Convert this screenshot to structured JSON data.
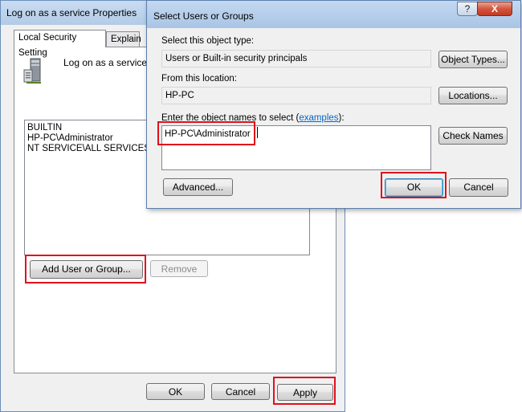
{
  "back_window": {
    "title": "Log on as a service Properties",
    "tabs": [
      "Local Security Setting",
      "Explain"
    ],
    "policy_name": "Log on as a service",
    "members": [
      "BUILTIN",
      "HP-PC\\Administrator",
      "NT SERVICE\\ALL SERVICES"
    ],
    "add_button": "Add User or Group...",
    "remove_button": "Remove",
    "ok_button": "OK",
    "cancel_button": "Cancel",
    "apply_button": "Apply"
  },
  "dialog": {
    "title": "Select Users or Groups",
    "help_glyph": "?",
    "close_glyph": "X",
    "object_type_label": "Select this object type:",
    "object_type_value": "Users or Built-in security principals",
    "object_types_button": "Object Types...",
    "location_label": "From this location:",
    "location_value": "HP-PC",
    "locations_button": "Locations...",
    "names_label_pre": "Enter the object names to select (",
    "names_label_link": "examples",
    "names_label_post": "):",
    "names_value": "HP-PC\\Administrator",
    "check_names_button": "Check Names",
    "advanced_button": "Advanced...",
    "ok_button": "OK",
    "cancel_button": "Cancel"
  },
  "colors": {
    "highlight": "#e0101c",
    "link": "#0066cc"
  }
}
